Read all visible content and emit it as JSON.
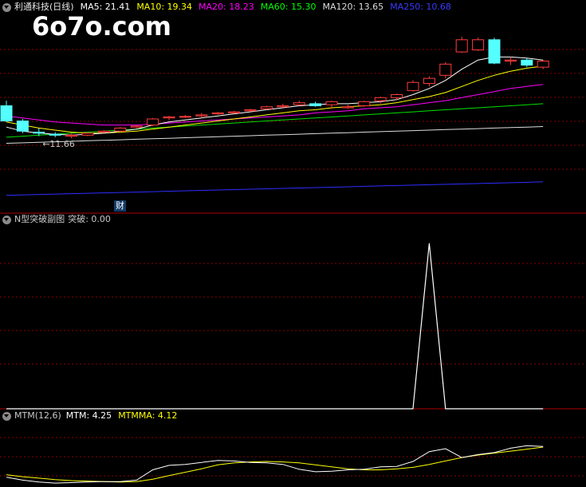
{
  "header": {
    "stock_name": "利通科技(日线)",
    "ma_items": [
      {
        "label": "MA5: 21.41",
        "color": "#ffffff"
      },
      {
        "label": "MA10: 19.34",
        "color": "#ffff00"
      },
      {
        "label": "MA20: 18.23",
        "color": "#ff00ff"
      },
      {
        "label": "MA60: 15.30",
        "color": "#00ff00"
      },
      {
        "label": "MA120: 13.65",
        "color": "#dcdcdc"
      },
      {
        "label": "MA250: 10.68",
        "color": "#3a3aff"
      }
    ]
  },
  "watermark": "6o7o.com",
  "price_marker": "←11.66",
  "finance_badge": "财",
  "indicator1": {
    "name": "N型突破副图",
    "value_label": "突破: 0.00"
  },
  "indicator2": {
    "name": "MTM(12,6)",
    "mtm_label": "MTM: 4.25",
    "mtmma_label": "MTMMA: 4.12",
    "mtm_color": "#ffffff",
    "mtmma_color": "#ffff00"
  },
  "colors": {
    "up": "#ff3b3b",
    "down": "#54ffff",
    "grid": "#8b0000",
    "divider": "#b00000"
  },
  "chart_data": [
    {
      "type": "candlestick",
      "ohlc": [
        [
          19.5,
          20.0,
          17.9,
          18.0
        ],
        [
          18.0,
          18.2,
          16.8,
          17.0
        ],
        [
          16.9,
          17.3,
          16.5,
          16.8
        ],
        [
          16.7,
          16.9,
          16.4,
          16.6
        ],
        [
          16.5,
          16.8,
          16.3,
          16.6
        ],
        [
          16.6,
          16.9,
          16.5,
          16.8
        ],
        [
          16.9,
          17.1,
          16.8,
          17.0
        ],
        [
          17.0,
          17.4,
          16.9,
          17.3
        ],
        [
          17.4,
          17.6,
          17.3,
          17.5
        ],
        [
          17.6,
          18.3,
          17.5,
          18.2
        ],
        [
          18.3,
          18.5,
          18.1,
          18.4
        ],
        [
          18.4,
          18.6,
          18.3,
          18.45
        ],
        [
          18.5,
          18.8,
          18.3,
          18.6
        ],
        [
          18.7,
          18.9,
          18.6,
          18.8
        ],
        [
          18.8,
          19.0,
          18.7,
          18.9
        ],
        [
          19.0,
          19.2,
          18.9,
          19.1
        ],
        [
          19.2,
          19.5,
          19.1,
          19.4
        ],
        [
          19.4,
          19.7,
          19.3,
          19.5
        ],
        [
          19.6,
          20.0,
          19.5,
          19.8
        ],
        [
          19.7,
          19.9,
          19.4,
          19.5
        ],
        [
          19.6,
          20.0,
          19.2,
          19.9
        ],
        [
          19.3,
          19.6,
          19.2,
          19.4
        ],
        [
          19.5,
          20.0,
          19.4,
          19.9
        ],
        [
          20.0,
          20.4,
          19.7,
          20.3
        ],
        [
          20.3,
          20.7,
          20.1,
          20.6
        ],
        [
          21.0,
          22.0,
          20.9,
          21.8
        ],
        [
          21.7,
          22.4,
          21.4,
          22.2
        ],
        [
          22.5,
          23.8,
          22.2,
          23.6
        ],
        [
          24.8,
          26.3,
          24.7,
          26.0
        ],
        [
          25.0,
          26.2,
          24.9,
          26.0
        ],
        [
          26.0,
          26.2,
          23.6,
          23.7
        ],
        [
          23.9,
          24.3,
          23.5,
          24.0
        ],
        [
          24.0,
          24.2,
          23.3,
          23.5
        ],
        [
          23.3,
          24.0,
          23.1,
          23.9
        ]
      ],
      "ma5": [
        17.4,
        17.0,
        16.8,
        16.7,
        16.6,
        16.7,
        16.8,
        17.0,
        17.2,
        17.6,
        17.9,
        18.1,
        18.3,
        18.5,
        18.7,
        18.9,
        19.1,
        19.3,
        19.5,
        19.6,
        19.7,
        19.7,
        19.8,
        19.9,
        20.1,
        20.6,
        21.2,
        22.0,
        23.1,
        24.0,
        24.3,
        24.3,
        24.2,
        24.0
      ],
      "ma10": [
        17.9,
        17.6,
        17.3,
        17.1,
        16.9,
        16.8,
        16.8,
        16.9,
        17.0,
        17.2,
        17.4,
        17.6,
        17.8,
        18.0,
        18.2,
        18.4,
        18.6,
        18.8,
        19.0,
        19.1,
        19.3,
        19.4,
        19.5,
        19.6,
        19.8,
        20.1,
        20.4,
        20.8,
        21.4,
        22.0,
        22.5,
        22.9,
        23.2,
        23.4
      ],
      "ma20": [
        18.5,
        18.3,
        18.1,
        17.9,
        17.8,
        17.7,
        17.6,
        17.6,
        17.6,
        17.7,
        17.8,
        17.9,
        18.0,
        18.1,
        18.2,
        18.3,
        18.4,
        18.5,
        18.6,
        18.8,
        18.9,
        19.0,
        19.2,
        19.3,
        19.4,
        19.6,
        19.8,
        20.0,
        20.3,
        20.6,
        20.9,
        21.2,
        21.4,
        21.6
      ],
      "ma60": [
        16.4,
        16.5,
        16.6,
        16.7,
        16.8,
        16.9,
        17.0,
        17.1,
        17.2,
        17.3,
        17.4,
        17.5,
        17.6,
        17.7,
        17.8,
        17.9,
        18.0,
        18.1,
        18.2,
        18.3,
        18.4,
        18.5,
        18.6,
        18.7,
        18.8,
        18.9,
        19.0,
        19.1,
        19.2,
        19.3,
        19.4,
        19.5,
        19.6,
        19.7
      ],
      "ma120": [
        15.8,
        15.85,
        15.9,
        15.95,
        16.0,
        16.05,
        16.1,
        16.15,
        16.2,
        16.25,
        16.3,
        16.35,
        16.4,
        16.45,
        16.5,
        16.55,
        16.6,
        16.65,
        16.7,
        16.75,
        16.8,
        16.85,
        16.9,
        16.95,
        17.0,
        17.05,
        17.1,
        17.15,
        17.2,
        17.25,
        17.3,
        17.35,
        17.4,
        17.45
      ],
      "ma250": [
        10.68,
        10.72,
        10.76,
        10.8,
        10.84,
        10.88,
        10.92,
        10.96,
        11.0,
        11.04,
        11.08,
        11.12,
        11.16,
        11.2,
        11.24,
        11.28,
        11.32,
        11.36,
        11.4,
        11.44,
        11.48,
        11.52,
        11.56,
        11.6,
        11.64,
        11.68,
        11.72,
        11.76,
        11.8,
        11.84,
        11.88,
        11.92,
        11.96,
        12.0
      ],
      "ylim": [
        9.0,
        28.5
      ]
    },
    {
      "type": "line",
      "name": "突破",
      "values": [
        0,
        0,
        0,
        0,
        0,
        0,
        0,
        0,
        0,
        0,
        0,
        0,
        0,
        0,
        0,
        0,
        0,
        0,
        0,
        0,
        0,
        0,
        0,
        0,
        0,
        0,
        1,
        0,
        0,
        0,
        0,
        0,
        0,
        0
      ],
      "ylim": [
        0,
        1.1
      ]
    },
    {
      "type": "line",
      "mtm": [
        -2.0,
        -2.6,
        -3.0,
        -3.2,
        -3.1,
        -3.0,
        -2.9,
        -2.9,
        -2.6,
        -0.5,
        0.4,
        0.6,
        1.0,
        1.4,
        1.3,
        1.0,
        0.9,
        0.6,
        -0.4,
        -0.9,
        -0.8,
        -0.5,
        -0.4,
        0.1,
        0.2,
        1.2,
        3.2,
        3.8,
        2.0,
        2.6,
        3.0,
        3.9,
        4.4,
        4.25
      ],
      "mtmma": [
        -1.5,
        -1.9,
        -2.2,
        -2.5,
        -2.7,
        -2.8,
        -2.9,
        -3.0,
        -2.9,
        -2.4,
        -1.7,
        -1.0,
        -0.3,
        0.5,
        0.9,
        1.1,
        1.2,
        1.1,
        0.9,
        0.5,
        0.1,
        -0.3,
        -0.5,
        -0.5,
        -0.3,
        0.0,
        0.6,
        1.3,
        2.0,
        2.5,
        2.9,
        3.3,
        3.7,
        4.12
      ],
      "ylim": [
        -4.0,
        9.0
      ]
    }
  ]
}
